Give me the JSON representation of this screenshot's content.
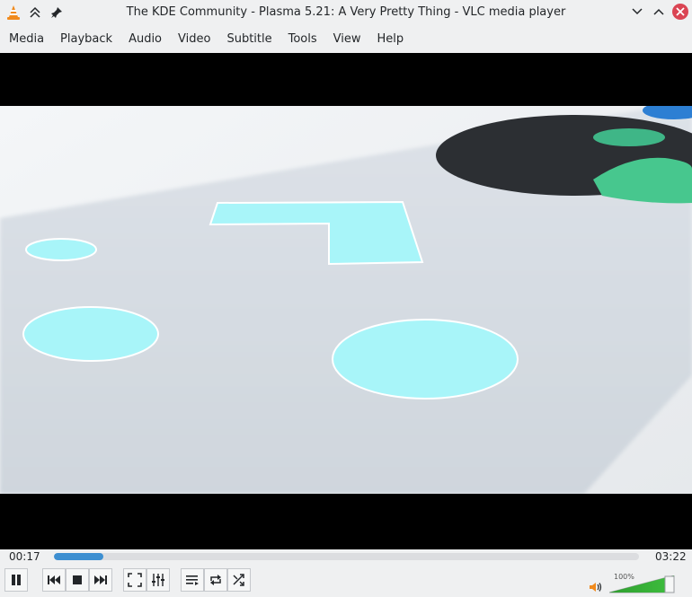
{
  "window": {
    "title": "The KDE Community - Plasma 5.21: A Very Pretty Thing - VLC media player",
    "icons": [
      "vlc-cone-icon",
      "keep-above-icon",
      "pin-icon",
      "minimize-icon",
      "maximize-icon",
      "close-icon"
    ]
  },
  "menu": {
    "items": [
      "Media",
      "Playback",
      "Audio",
      "Video",
      "Subtitle",
      "Tools",
      "View",
      "Help"
    ]
  },
  "player": {
    "elapsed": "00:17",
    "duration": "03:22",
    "progress_fraction": 0.084,
    "volume_label": "100%",
    "volume_fraction": 1.0
  },
  "controls": {
    "icons": [
      "pause-icon",
      "previous-icon",
      "stop-icon",
      "next-icon",
      "fullscreen-icon",
      "extended-settings-icon",
      "playlist-icon",
      "loop-icon",
      "shuffle-icon",
      "speaker-icon"
    ]
  },
  "colors": {
    "accent": "#3d8fd1",
    "close": "#da4453",
    "volume_green": "#3fbf3f"
  }
}
